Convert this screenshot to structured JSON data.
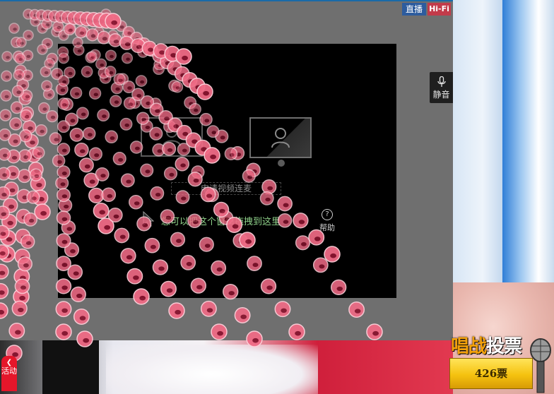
{
  "badges": {
    "live": "直播",
    "hifi": "Hi-Fi"
  },
  "mute_button": {
    "label": "静音",
    "icon": "microphone-icon"
  },
  "video_panel": {
    "connect_label": "申请视频连麦",
    "hint": "您可以把这个窗口拖拽到这里",
    "help_label": "帮助",
    "icons": [
      "user-screen-icon",
      "monitor-icon",
      "cursor-icon",
      "help-icon"
    ]
  },
  "activity_tab": {
    "label": "活动",
    "icon": "chevron-left-icon"
  },
  "vote": {
    "title_accent": "唱战",
    "title": "投票",
    "count": "426票"
  },
  "colors": {
    "overlay_grey": "#6f6f6f",
    "panel_black": "#000000",
    "hint_green": "#8fd18a",
    "live_blue": "#2d5c9e",
    "hifi_red": "#c23b4a",
    "activity_red": "#e5162a",
    "vote_gold": "#f5c20f",
    "pig_pink": "#f06b86"
  }
}
